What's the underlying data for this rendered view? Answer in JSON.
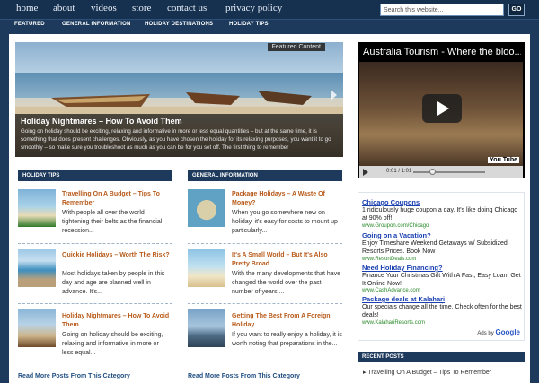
{
  "topnav": {
    "links": [
      "home",
      "about",
      "videos",
      "store",
      "contact us",
      "privacy policy"
    ],
    "search_placeholder": "Search this website...",
    "go_label": "GO"
  },
  "catnav": [
    "FEATURED",
    "GENERAL INFORMATION",
    "HOLIDAY DESTINATIONS",
    "HOLIDAY TIPS"
  ],
  "featured": {
    "tag": "Featured Content",
    "title": "Holiday Nightmares – How To Avoid Them",
    "text": "Going on holiday should be exciting, relaxing and informative in more or less equal quantities – but at the same time, it is something that does present challenges. Obviously, as you have chosen the holiday for its relaxing purposes, you want it to go smoothly – so make sure you troubleshoot as much as you can be for you set off. The first thing to remember"
  },
  "video": {
    "title": "Australia Tourism - Where the bloo...",
    "time": "0:01 / 1:01",
    "yt": "You Tube"
  },
  "holiday_tips": {
    "heading": "HOLIDAY TIPS",
    "posts": [
      {
        "title": "Travelling On A Budget – Tips To Remember",
        "text": "With people all over the world tightening their belts as the financial recession..."
      },
      {
        "title": "Quickie Holidays – Worth The Risk?",
        "text": "Most holidays taken by people in this day and age are planned well in advance. It's..."
      },
      {
        "title": "Holiday Nightmares – How To Avoid Them",
        "text": "Going on holiday should be exciting, relaxing and informative in more or less equal..."
      }
    ],
    "read_more": "Read More Posts From This Category"
  },
  "general_information": {
    "heading": "GENERAL INFORMATION",
    "posts": [
      {
        "title": "Package Holidays – A Waste Of Money?",
        "text": "When you go somewhere new on holiday, it's easy for costs to mount up – particularly..."
      },
      {
        "title": "It's A Small World – But It's Also Pretty Broad",
        "text": "With the many developments that have changed the world over the past number of years,..."
      },
      {
        "title": "Getting The Best From A Foreign Holiday",
        "text": "If you want to really enjoy a holiday, it is worth noting that preparations in the..."
      }
    ],
    "read_more": "Read More Posts From This Category"
  },
  "ads": [
    {
      "title": "Chicago Coupons",
      "text": "1 ridiculously huge coupon a day. It's like doing Chicago at 90% off!",
      "url": "www.Groupon.com/Chicago"
    },
    {
      "title": "Going on a Vacation?",
      "text": "Enjoy Timeshare Weekend Getaways w/ Subsidized Resorts Prices. Book Now",
      "url": "www.ResortDeals.com"
    },
    {
      "title": "Need Holiday Financing?",
      "text": "Finance Your Christmas Gift With A Fast, Easy Loan. Get It Online Now!",
      "url": "www.CashAdvance.com"
    },
    {
      "title": "Package deals at Kalahari",
      "text": "Our specials change all the time. Check often for the best deals!",
      "url": "www.KalahariResorts.com"
    }
  ],
  "ads_by": "Ads by",
  "ads_brand": "Google",
  "recent_posts": {
    "heading": "RECENT POSTS",
    "items": [
      "Travelling On A Budget – Tips To Remember"
    ]
  }
}
